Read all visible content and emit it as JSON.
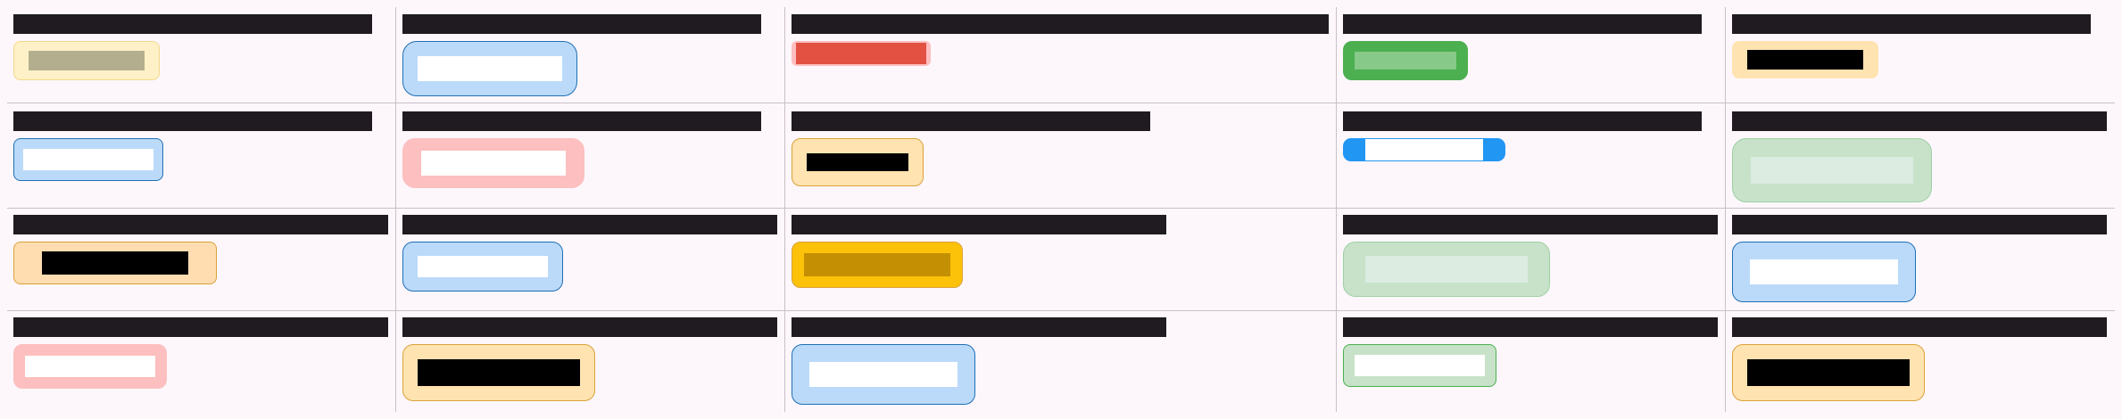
{
  "grid": {
    "rows": [
      {
        "cells": [
          {
            "label": "",
            "chip_text": ""
          },
          {
            "label": "",
            "chip_text": ""
          },
          {
            "label": "",
            "chip_text": ""
          },
          {
            "label": "",
            "chip_text": ""
          },
          {
            "label": "",
            "chip_text": ""
          }
        ]
      },
      {
        "cells": [
          {
            "label": "",
            "chip_text": ""
          },
          {
            "label": "",
            "chip_text": ""
          },
          {
            "label": "",
            "chip_text": ""
          },
          {
            "label": "",
            "chip_text": ""
          },
          {
            "label": "",
            "chip_text": ""
          }
        ]
      },
      {
        "cells": [
          {
            "label": "",
            "chip_text": ""
          },
          {
            "label": "",
            "chip_text": ""
          },
          {
            "label": "",
            "chip_text": ""
          },
          {
            "label": "",
            "chip_text": ""
          },
          {
            "label": "",
            "chip_text": ""
          }
        ]
      },
      {
        "cells": [
          {
            "label": "",
            "chip_text": ""
          },
          {
            "label": "",
            "chip_text": ""
          },
          {
            "label": "",
            "chip_text": ""
          },
          {
            "label": "",
            "chip_text": ""
          },
          {
            "label": "",
            "chip_text": ""
          }
        ]
      }
    ]
  },
  "colors": {
    "background": "#fdf7fc",
    "label_bar": "#1f1b20",
    "divider": "#c7c1c7",
    "yellow_light": "#fff1c7",
    "olive_text": "#b3ae8e",
    "blue_light": "#bbdafa",
    "blue_border": "#1f6fb4",
    "red": "#e35142",
    "pink_light": "#fdbfbf",
    "green": "#4caf50",
    "green_light": "#c7e2c9",
    "peach": "#ffe3b0",
    "orange_border": "#d9a23a",
    "gold": "#fcc109",
    "gold_dark": "#c48f02",
    "blue_accent": "#2196f3"
  }
}
